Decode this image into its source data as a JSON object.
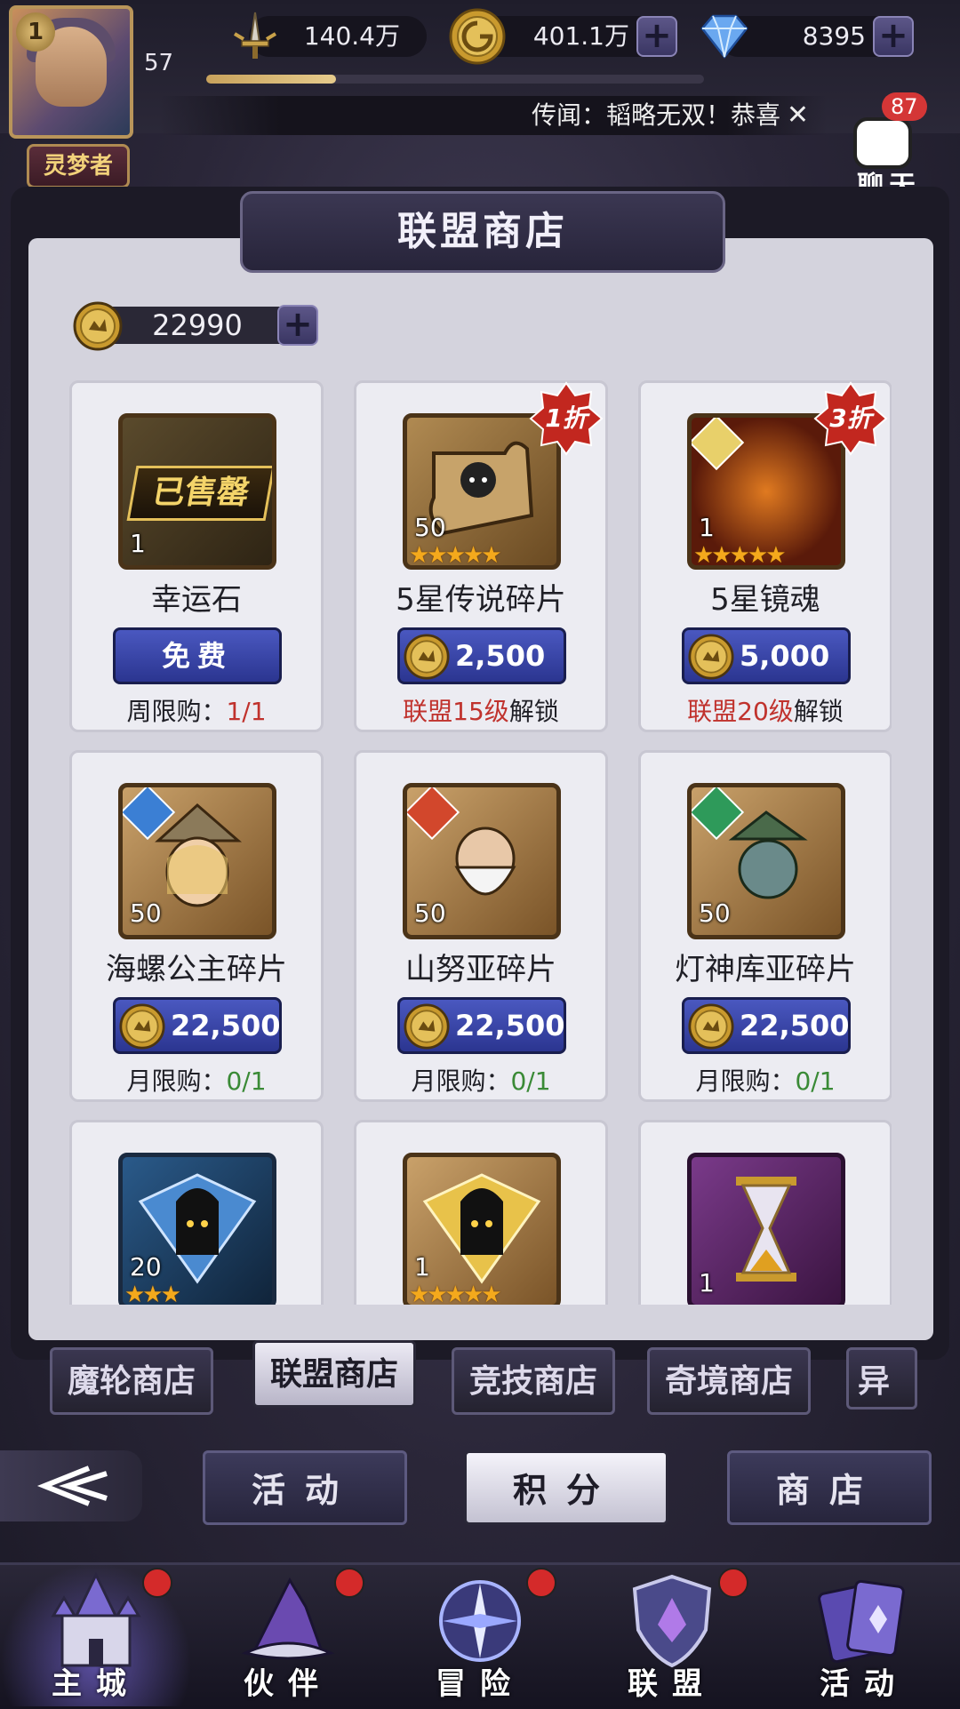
{
  "player": {
    "vip_level": "1",
    "level": "57",
    "xp_fraction": 0.26,
    "title_badge": "灵梦者",
    "title_stars": "◆◆◆◆◆"
  },
  "resources": {
    "power": "140.4万",
    "gold": "401.1万",
    "diamonds": "8395",
    "plus": "+"
  },
  "rumor": {
    "text": "传闻：韬略无双！恭喜",
    "close": "✕"
  },
  "chat": {
    "badge": "87",
    "label": "聊天"
  },
  "shop": {
    "title": "联盟商店",
    "points": "22990",
    "items": [
      {
        "name": "幸运石",
        "qty": "1",
        "sold_out": "已售罄",
        "price": "免费",
        "limit_label": "周限购：",
        "limit_value": "1/1",
        "icon": "lucky-stone-icon"
      },
      {
        "name": "5星传说碎片",
        "qty": "50",
        "discount": "1折",
        "stars": "★★★★★",
        "price": "2,500",
        "unlock_red": "联盟15级",
        "unlock_suffix": "解锁",
        "icon": "legend-shard-icon"
      },
      {
        "name": "5星镜魂",
        "qty": "1",
        "discount": "3折",
        "stars": "★★★★★",
        "price": "5,000",
        "unlock_red": "联盟20级",
        "unlock_suffix": "解锁",
        "icon": "mirror-soul-icon"
      },
      {
        "name": "海螺公主碎片",
        "qty": "50",
        "price": "22,500",
        "limit_label": "月限购：",
        "limit_value": "0/1",
        "icon": "conch-princess-shard-icon"
      },
      {
        "name": "山努亚碎片",
        "qty": "50",
        "price": "22,500",
        "limit_label": "月限购：",
        "limit_value": "0/1",
        "icon": "shannuya-shard-icon"
      },
      {
        "name": "灯神库亚碎片",
        "qty": "50",
        "price": "22,500",
        "limit_label": "月限购：",
        "limit_value": "0/1",
        "icon": "genie-kuya-shard-icon"
      },
      {
        "qty": "20",
        "stars": "★★★",
        "icon": "blue-hooded-shard-icon"
      },
      {
        "qty": "1",
        "stars": "★★★★★",
        "icon": "gold-hooded-shard-icon"
      },
      {
        "qty": "1",
        "icon": "hourglass-icon"
      }
    ]
  },
  "shop_tabs": [
    "魔轮商店",
    "联盟商店",
    "竞技商店",
    "奇境商店",
    "异界"
  ],
  "sub_tabs": [
    "活动",
    "积分",
    "商店"
  ],
  "bottom_nav": [
    "主城",
    "伙伴",
    "冒险",
    "联盟",
    "活动"
  ],
  "colors": {
    "accent_blue": "#3a46a8",
    "red_text": "#c0322d",
    "green_text": "#3a8a36",
    "star": "#f4a91c"
  }
}
